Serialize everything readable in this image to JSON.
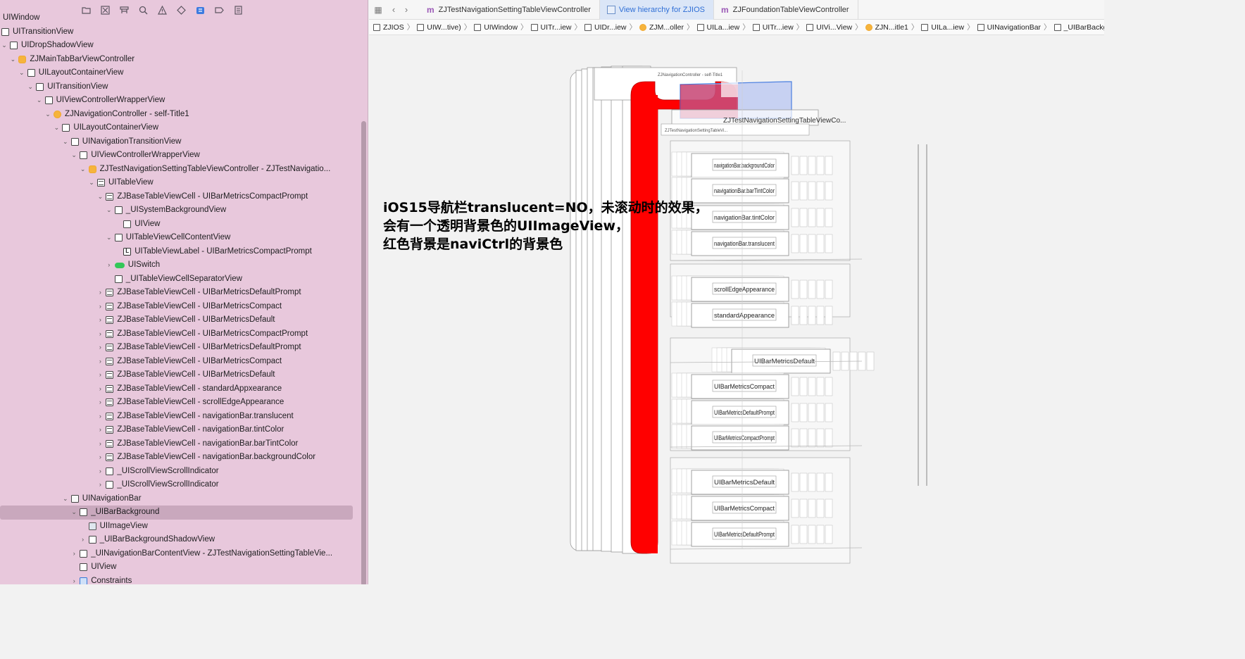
{
  "navigator": {
    "tree": [
      {
        "label": "UIWindow",
        "depth": 0,
        "icon": "none",
        "disclosure": ""
      },
      {
        "label": "UITransitionView",
        "depth": 0,
        "icon": "view",
        "disclosure": ""
      },
      {
        "label": "UIDropShadowView",
        "depth": 0,
        "icon": "view",
        "disclosure": "v"
      },
      {
        "label": "ZJMainTabBarViewController",
        "depth": 1,
        "icon": "vc",
        "disclosure": "v"
      },
      {
        "label": "UILayoutContainerView",
        "depth": 2,
        "icon": "view",
        "disclosure": "v"
      },
      {
        "label": "UITransitionView",
        "depth": 3,
        "icon": "view",
        "disclosure": "v"
      },
      {
        "label": "UIViewControllerWrapperView",
        "depth": 4,
        "icon": "view",
        "disclosure": "v"
      },
      {
        "label": "ZJNavigationController - self-Title1",
        "depth": 5,
        "icon": "nav",
        "disclosure": "v"
      },
      {
        "label": "UILayoutContainerView",
        "depth": 6,
        "icon": "view",
        "disclosure": "v"
      },
      {
        "label": "UINavigationTransitionView",
        "depth": 7,
        "icon": "view",
        "disclosure": "v"
      },
      {
        "label": "UIViewControllerWrapperView",
        "depth": 8,
        "icon": "view",
        "disclosure": "v"
      },
      {
        "label": "ZJTestNavigationSettingTableViewController - ZJTestNavigatio...",
        "depth": 9,
        "icon": "vc",
        "disclosure": "v"
      },
      {
        "label": "UITableView",
        "depth": 10,
        "icon": "table",
        "disclosure": "v"
      },
      {
        "label": "ZJBaseTableViewCell - UIBarMetricsCompactPrompt",
        "depth": 11,
        "icon": "table",
        "disclosure": "v"
      },
      {
        "label": "_UISystemBackgroundView",
        "depth": 12,
        "icon": "view",
        "disclosure": "v"
      },
      {
        "label": "UIView",
        "depth": 13,
        "icon": "view",
        "disclosure": ""
      },
      {
        "label": "UITableViewCellContentView",
        "depth": 12,
        "icon": "view",
        "disclosure": "v"
      },
      {
        "label": "UITableViewLabel - UIBarMetricsCompactPrompt",
        "depth": 13,
        "icon": "label",
        "disclosure": ""
      },
      {
        "label": "UISwitch",
        "depth": 12,
        "icon": "switch",
        "disclosure": ">"
      },
      {
        "label": "_UITableViewCellSeparatorView",
        "depth": 12,
        "icon": "view",
        "disclosure": ""
      },
      {
        "label": "ZJBaseTableViewCell - UIBarMetricsDefaultPrompt",
        "depth": 11,
        "icon": "table",
        "disclosure": ">"
      },
      {
        "label": "ZJBaseTableViewCell - UIBarMetricsCompact",
        "depth": 11,
        "icon": "table",
        "disclosure": ">"
      },
      {
        "label": "ZJBaseTableViewCell - UIBarMetricsDefault",
        "depth": 11,
        "icon": "table",
        "disclosure": ">"
      },
      {
        "label": "ZJBaseTableViewCell - UIBarMetricsCompactPrompt",
        "depth": 11,
        "icon": "table",
        "disclosure": ">"
      },
      {
        "label": "ZJBaseTableViewCell - UIBarMetricsDefaultPrompt",
        "depth": 11,
        "icon": "table",
        "disclosure": ">"
      },
      {
        "label": "ZJBaseTableViewCell - UIBarMetricsCompact",
        "depth": 11,
        "icon": "table",
        "disclosure": ">"
      },
      {
        "label": "ZJBaseTableViewCell - UIBarMetricsDefault",
        "depth": 11,
        "icon": "table",
        "disclosure": ">"
      },
      {
        "label": "ZJBaseTableViewCell - standardAppxearance",
        "depth": 11,
        "icon": "table",
        "disclosure": ">"
      },
      {
        "label": "ZJBaseTableViewCell - scrollEdgeAppearance",
        "depth": 11,
        "icon": "table",
        "disclosure": ">"
      },
      {
        "label": "ZJBaseTableViewCell - navigationBar.translucent",
        "depth": 11,
        "icon": "table",
        "disclosure": ">"
      },
      {
        "label": "ZJBaseTableViewCell - navigationBar.tintColor",
        "depth": 11,
        "icon": "table",
        "disclosure": ">"
      },
      {
        "label": "ZJBaseTableViewCell - navigationBar.barTintColor",
        "depth": 11,
        "icon": "table",
        "disclosure": ">"
      },
      {
        "label": "ZJBaseTableViewCell - navigationBar.backgroundColor",
        "depth": 11,
        "icon": "table",
        "disclosure": ">"
      },
      {
        "label": "_UIScrollViewScrollIndicator",
        "depth": 11,
        "icon": "view",
        "disclosure": ">"
      },
      {
        "label": "_UIScrollViewScrollIndicator",
        "depth": 11,
        "icon": "view",
        "disclosure": ">"
      },
      {
        "label": "UINavigationBar",
        "depth": 7,
        "icon": "navbar",
        "disclosure": "v"
      },
      {
        "label": "_UIBarBackground",
        "depth": 8,
        "icon": "view",
        "disclosure": "v",
        "selected": true
      },
      {
        "label": "UIImageView",
        "depth": 9,
        "icon": "img",
        "disclosure": ""
      },
      {
        "label": "_UIBarBackgroundShadowView",
        "depth": 9,
        "icon": "view",
        "disclosure": ">"
      },
      {
        "label": "_UINavigationBarContentView - ZJTestNavigationSettingTableVie...",
        "depth": 8,
        "icon": "view",
        "disclosure": ">"
      },
      {
        "label": "UIView",
        "depth": 8,
        "icon": "view",
        "disclosure": ""
      },
      {
        "label": "Constraints",
        "depth": 8,
        "icon": "constraints",
        "disclosure": ">"
      }
    ]
  },
  "tabs": [
    {
      "label": "ZJTestNavigationSettingTableViewController",
      "kind": "m",
      "active": false
    },
    {
      "label": "View hierarchy for ZJIOS",
      "kind": "vh",
      "active": true
    },
    {
      "label": "ZJFoundationTableViewController",
      "kind": "m",
      "active": false
    }
  ],
  "breadcrumbs": [
    {
      "label": "ZJIOS",
      "icon": "view"
    },
    {
      "label": "UIW...tive)",
      "icon": "view"
    },
    {
      "label": "UIWindow",
      "icon": "view"
    },
    {
      "label": "UITr...iew",
      "icon": "view"
    },
    {
      "label": "UIDr...iew",
      "icon": "view"
    },
    {
      "label": "ZJM...oller",
      "icon": "vc"
    },
    {
      "label": "UILa...iew",
      "icon": "view"
    },
    {
      "label": "UITr...iew",
      "icon": "view"
    },
    {
      "label": "UIVi...View",
      "icon": "view"
    },
    {
      "label": "ZJN...itle1",
      "icon": "vc"
    },
    {
      "label": "UILa...iew",
      "icon": "view"
    },
    {
      "label": "UINavigationBar",
      "icon": "view"
    },
    {
      "label": "_UIBarBackground",
      "icon": "view"
    }
  ],
  "annotation": {
    "line1": "iOS15导航栏translucent=NO，未滚动时的效果，",
    "line2": "会有一个透明背景色的UIImageView，",
    "line3": "红色背景是naviCtrl的背景色"
  },
  "hierarchy_labels": {
    "nav_title": "ZJTestNavigationSettingTableViewCo...",
    "small_title": "ZJNavigationController - self-Title1",
    "small_title2": "ZJTestNavigationSettingTableVi...",
    "cells": [
      "navigationBar.backgroundColor",
      "navigationBar.barTintColor",
      "navigationBar.tintColor",
      "navigationBar.translucent",
      "scrollEdgeAppearance",
      "standardAppearance",
      "UIBarMetricsDefault",
      "UIBarMetricsCompact",
      "UIBarMetricsDefaultPrompt",
      "UIBarMetricsCompactPrompt",
      "UIBarMetricsDefault",
      "UIBarMetricsCompact",
      "UIBarMetricsDefaultPrompt"
    ]
  },
  "colors": {
    "navigator_bg": "#e8c8dc",
    "nav_ctrl_bg": "#ff0000",
    "selection_blue": "#4a7fe0"
  }
}
